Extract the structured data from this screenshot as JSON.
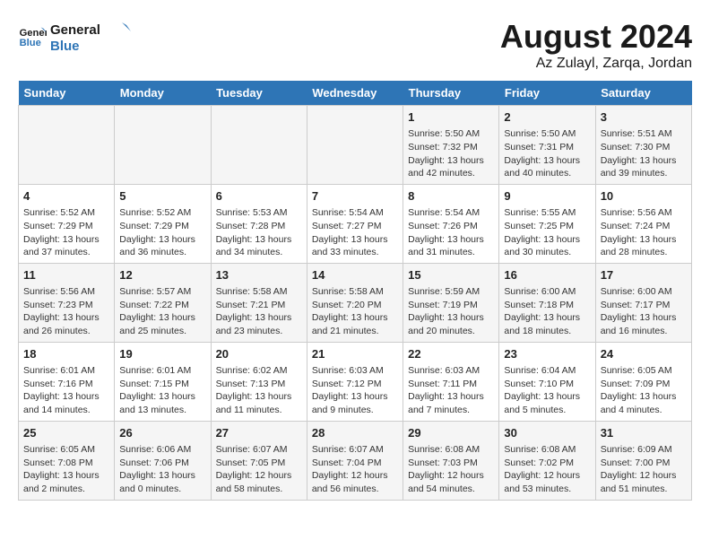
{
  "header": {
    "logo_line1": "General",
    "logo_line2": "Blue",
    "title": "August 2024",
    "subtitle": "Az Zulayl, Zarqa, Jordan"
  },
  "days_of_week": [
    "Sunday",
    "Monday",
    "Tuesday",
    "Wednesday",
    "Thursday",
    "Friday",
    "Saturday"
  ],
  "weeks": [
    [
      {
        "day": "",
        "info": ""
      },
      {
        "day": "",
        "info": ""
      },
      {
        "day": "",
        "info": ""
      },
      {
        "day": "",
        "info": ""
      },
      {
        "day": "1",
        "info": "Sunrise: 5:50 AM\nSunset: 7:32 PM\nDaylight: 13 hours\nand 42 minutes."
      },
      {
        "day": "2",
        "info": "Sunrise: 5:50 AM\nSunset: 7:31 PM\nDaylight: 13 hours\nand 40 minutes."
      },
      {
        "day": "3",
        "info": "Sunrise: 5:51 AM\nSunset: 7:30 PM\nDaylight: 13 hours\nand 39 minutes."
      }
    ],
    [
      {
        "day": "4",
        "info": "Sunrise: 5:52 AM\nSunset: 7:29 PM\nDaylight: 13 hours\nand 37 minutes."
      },
      {
        "day": "5",
        "info": "Sunrise: 5:52 AM\nSunset: 7:29 PM\nDaylight: 13 hours\nand 36 minutes."
      },
      {
        "day": "6",
        "info": "Sunrise: 5:53 AM\nSunset: 7:28 PM\nDaylight: 13 hours\nand 34 minutes."
      },
      {
        "day": "7",
        "info": "Sunrise: 5:54 AM\nSunset: 7:27 PM\nDaylight: 13 hours\nand 33 minutes."
      },
      {
        "day": "8",
        "info": "Sunrise: 5:54 AM\nSunset: 7:26 PM\nDaylight: 13 hours\nand 31 minutes."
      },
      {
        "day": "9",
        "info": "Sunrise: 5:55 AM\nSunset: 7:25 PM\nDaylight: 13 hours\nand 30 minutes."
      },
      {
        "day": "10",
        "info": "Sunrise: 5:56 AM\nSunset: 7:24 PM\nDaylight: 13 hours\nand 28 minutes."
      }
    ],
    [
      {
        "day": "11",
        "info": "Sunrise: 5:56 AM\nSunset: 7:23 PM\nDaylight: 13 hours\nand 26 minutes."
      },
      {
        "day": "12",
        "info": "Sunrise: 5:57 AM\nSunset: 7:22 PM\nDaylight: 13 hours\nand 25 minutes."
      },
      {
        "day": "13",
        "info": "Sunrise: 5:58 AM\nSunset: 7:21 PM\nDaylight: 13 hours\nand 23 minutes."
      },
      {
        "day": "14",
        "info": "Sunrise: 5:58 AM\nSunset: 7:20 PM\nDaylight: 13 hours\nand 21 minutes."
      },
      {
        "day": "15",
        "info": "Sunrise: 5:59 AM\nSunset: 7:19 PM\nDaylight: 13 hours\nand 20 minutes."
      },
      {
        "day": "16",
        "info": "Sunrise: 6:00 AM\nSunset: 7:18 PM\nDaylight: 13 hours\nand 18 minutes."
      },
      {
        "day": "17",
        "info": "Sunrise: 6:00 AM\nSunset: 7:17 PM\nDaylight: 13 hours\nand 16 minutes."
      }
    ],
    [
      {
        "day": "18",
        "info": "Sunrise: 6:01 AM\nSunset: 7:16 PM\nDaylight: 13 hours\nand 14 minutes."
      },
      {
        "day": "19",
        "info": "Sunrise: 6:01 AM\nSunset: 7:15 PM\nDaylight: 13 hours\nand 13 minutes."
      },
      {
        "day": "20",
        "info": "Sunrise: 6:02 AM\nSunset: 7:13 PM\nDaylight: 13 hours\nand 11 minutes."
      },
      {
        "day": "21",
        "info": "Sunrise: 6:03 AM\nSunset: 7:12 PM\nDaylight: 13 hours\nand 9 minutes."
      },
      {
        "day": "22",
        "info": "Sunrise: 6:03 AM\nSunset: 7:11 PM\nDaylight: 13 hours\nand 7 minutes."
      },
      {
        "day": "23",
        "info": "Sunrise: 6:04 AM\nSunset: 7:10 PM\nDaylight: 13 hours\nand 5 minutes."
      },
      {
        "day": "24",
        "info": "Sunrise: 6:05 AM\nSunset: 7:09 PM\nDaylight: 13 hours\nand 4 minutes."
      }
    ],
    [
      {
        "day": "25",
        "info": "Sunrise: 6:05 AM\nSunset: 7:08 PM\nDaylight: 13 hours\nand 2 minutes."
      },
      {
        "day": "26",
        "info": "Sunrise: 6:06 AM\nSunset: 7:06 PM\nDaylight: 13 hours\nand 0 minutes."
      },
      {
        "day": "27",
        "info": "Sunrise: 6:07 AM\nSunset: 7:05 PM\nDaylight: 12 hours\nand 58 minutes."
      },
      {
        "day": "28",
        "info": "Sunrise: 6:07 AM\nSunset: 7:04 PM\nDaylight: 12 hours\nand 56 minutes."
      },
      {
        "day": "29",
        "info": "Sunrise: 6:08 AM\nSunset: 7:03 PM\nDaylight: 12 hours\nand 54 minutes."
      },
      {
        "day": "30",
        "info": "Sunrise: 6:08 AM\nSunset: 7:02 PM\nDaylight: 12 hours\nand 53 minutes."
      },
      {
        "day": "31",
        "info": "Sunrise: 6:09 AM\nSunset: 7:00 PM\nDaylight: 12 hours\nand 51 minutes."
      }
    ]
  ]
}
